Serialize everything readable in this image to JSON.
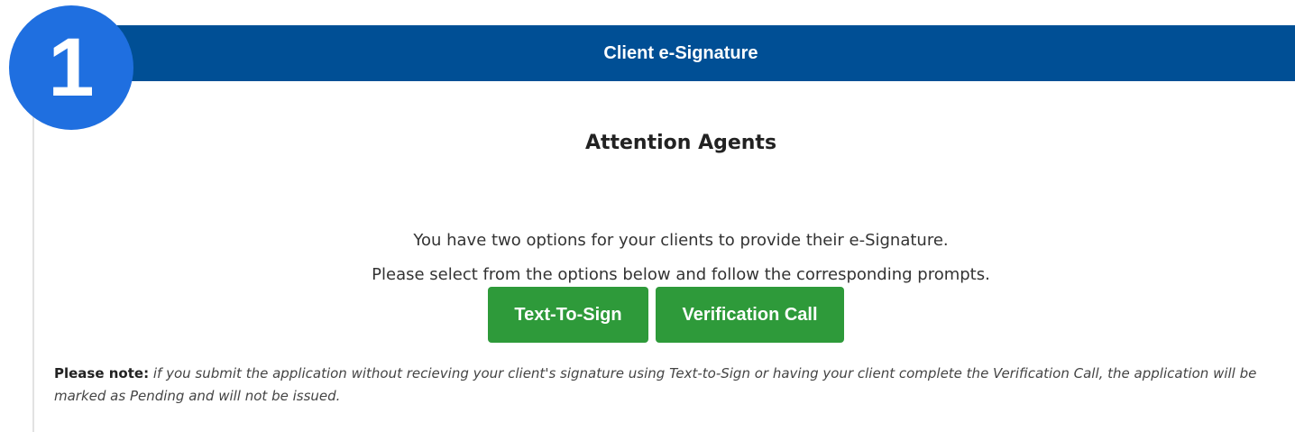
{
  "badge": {
    "number": "1"
  },
  "header": {
    "title": "Client e-Signature"
  },
  "content": {
    "heading": "Attention Agents",
    "intro_line_1": "You have two options for your clients to provide their e-Signature.",
    "intro_line_2": "Please select from the options below and follow the corresponding prompts."
  },
  "buttons": {
    "text_to_sign": "Text-To-Sign",
    "verification_call": "Verification Call"
  },
  "note": {
    "label": "Please note:",
    "text": "if you submit the application without recieving your client's signature using Text-to-Sign or having your client complete the Verification Call, the application will be marked as Pending and will not be issued."
  },
  "colors": {
    "header_bg": "#004f95",
    "badge_bg": "#1f6fe0",
    "button_bg": "#2e9a3a"
  }
}
